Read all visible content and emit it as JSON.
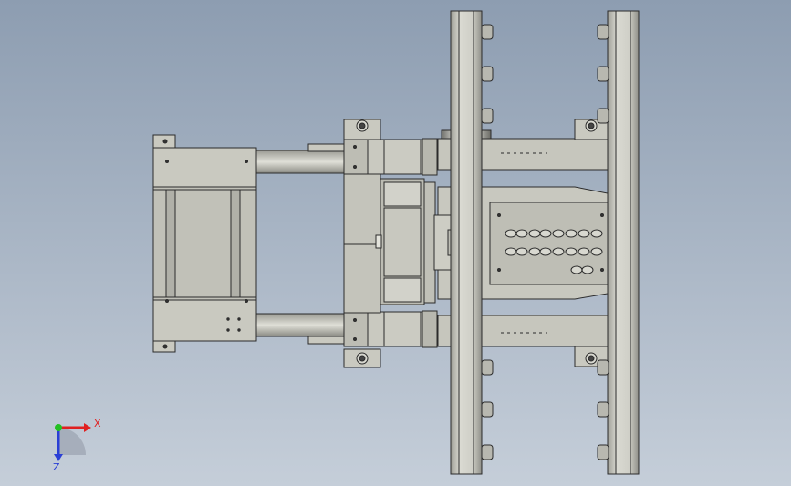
{
  "view": {
    "background_top": "#8d9db1",
    "background_bottom": "#c5ced9"
  },
  "model": {
    "part_fill": "#c9c9c0",
    "part_fill_dark": "#b3b3aa",
    "edge_color": "#2b2b2b",
    "rail_fill": "#cfcfc6"
  },
  "triad": {
    "x_label": "X",
    "z_label": "Z",
    "x_color": "#e02020",
    "y_color": "#22c022",
    "z_color": "#2a3fd6"
  }
}
